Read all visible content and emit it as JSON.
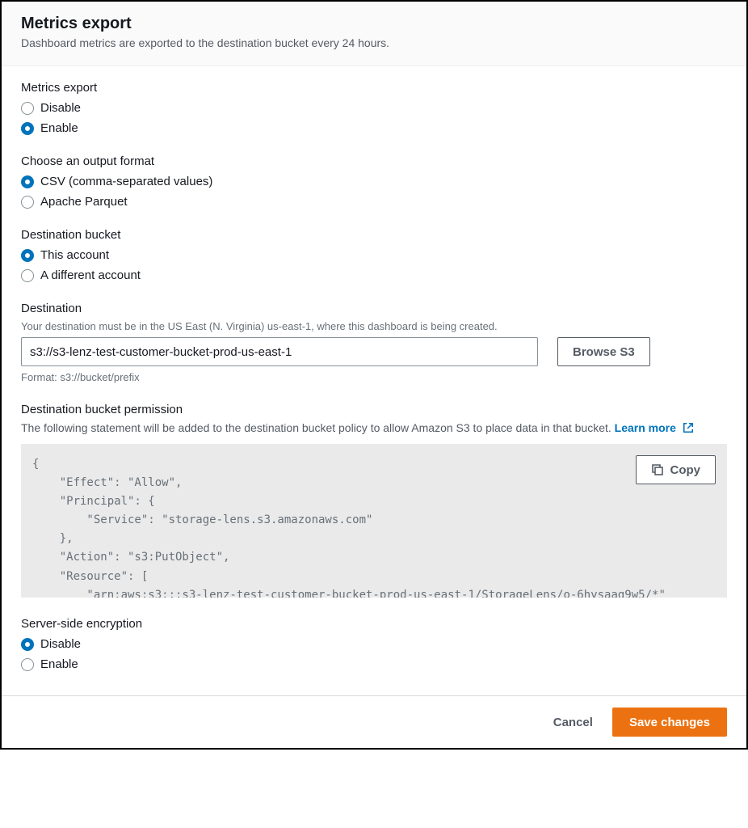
{
  "header": {
    "title": "Metrics export",
    "subtitle": "Dashboard metrics are exported to the destination bucket every 24 hours."
  },
  "metrics_export": {
    "label": "Metrics export",
    "options": {
      "disable": "Disable",
      "enable": "Enable"
    },
    "selected": "enable"
  },
  "output_format": {
    "label": "Choose an output format",
    "options": {
      "csv": "CSV (comma-separated values)",
      "parquet": "Apache Parquet"
    },
    "selected": "csv"
  },
  "dest_bucket": {
    "label": "Destination bucket",
    "options": {
      "this": "This account",
      "other": "A different account"
    },
    "selected": "this"
  },
  "destination": {
    "label": "Destination",
    "hint": "Your destination must be in the US East (N. Virginia) us-east-1, where this dashboard is being created.",
    "value": "s3://s3-lenz-test-customer-bucket-prod-us-east-1",
    "browse_label": "Browse S3",
    "format_hint": "Format: s3://bucket/prefix"
  },
  "permission": {
    "label": "Destination bucket permission",
    "desc": "The following statement will be added to the destination bucket policy to allow Amazon S3 to place data in that bucket. ",
    "learn_more": "Learn more",
    "copy_label": "Copy",
    "policy": "{\n    \"Effect\": \"Allow\",\n    \"Principal\": {\n        \"Service\": \"storage-lens.s3.amazonaws.com\"\n    },\n    \"Action\": \"s3:PutObject\",\n    \"Resource\": [\n        \"arn:aws:s3:::s3-lenz-test-customer-bucket-prod-us-east-1/StorageLens/o-6hysaag9w5/*\""
  },
  "sse": {
    "label": "Server-side encryption",
    "options": {
      "disable": "Disable",
      "enable": "Enable"
    },
    "selected": "disable"
  },
  "footer": {
    "cancel": "Cancel",
    "save": "Save changes"
  }
}
